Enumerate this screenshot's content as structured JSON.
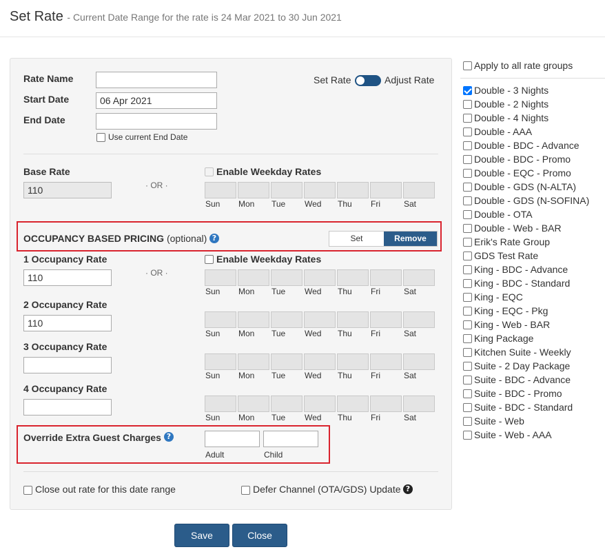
{
  "header": {
    "title": "Set Rate",
    "subtitle": "- Current Date Range for the rate is 24 Mar 2021 to 30 Jun 2021"
  },
  "form": {
    "rate_name_label": "Rate Name",
    "rate_name_value": "",
    "start_date_label": "Start Date",
    "start_date_value": "06 Apr 2021",
    "end_date_label": "End Date",
    "end_date_value": "",
    "use_current_end_date": "Use current End Date",
    "set_rate_label": "Set Rate",
    "adjust_rate_label": "Adjust Rate",
    "base_rate_label": "Base Rate",
    "base_rate_value": "110",
    "or": "· OR ·",
    "enable_weekday_rates": "Enable Weekday Rates",
    "days": [
      "Sun",
      "Mon",
      "Tue",
      "Wed",
      "Thu",
      "Fri",
      "Sat"
    ]
  },
  "occupancy": {
    "title": "OCCUPANCY BASED PRICING",
    "optional": "(optional)",
    "set_label": "Set",
    "remove_label": "Remove",
    "rates": [
      {
        "label": "1 Occupancy Rate",
        "value": "110"
      },
      {
        "label": "2 Occupancy Rate",
        "value": "110"
      },
      {
        "label": "3 Occupancy Rate",
        "value": ""
      },
      {
        "label": "4 Occupancy Rate",
        "value": ""
      }
    ]
  },
  "extra_guest": {
    "label": "Override Extra Guest Charges",
    "adult_label": "Adult",
    "child_label": "Child"
  },
  "footer_options": {
    "close_out": "Close out rate for this date range",
    "defer_channel": "Defer Channel (OTA/GDS) Update"
  },
  "buttons": {
    "save": "Save",
    "close": "Close"
  },
  "rate_groups": {
    "apply_all": "Apply to all rate groups",
    "items": [
      {
        "label": "Double - 3 Nights",
        "checked": true
      },
      {
        "label": "Double - 2 Nights",
        "checked": false
      },
      {
        "label": "Double - 4 Nights",
        "checked": false
      },
      {
        "label": "Double - AAA",
        "checked": false
      },
      {
        "label": "Double - BDC - Advance",
        "checked": false
      },
      {
        "label": "Double - BDC - Promo",
        "checked": false
      },
      {
        "label": "Double - EQC - Promo",
        "checked": false
      },
      {
        "label": "Double - GDS (N-ALTA)",
        "checked": false
      },
      {
        "label": "Double - GDS (N-SOFINA)",
        "checked": false
      },
      {
        "label": "Double - OTA",
        "checked": false
      },
      {
        "label": "Double - Web - BAR",
        "checked": false
      },
      {
        "label": "Erik's Rate Group",
        "checked": false
      },
      {
        "label": "GDS Test Rate",
        "checked": false
      },
      {
        "label": "King - BDC - Advance",
        "checked": false
      },
      {
        "label": "King - BDC - Standard",
        "checked": false
      },
      {
        "label": "King - EQC",
        "checked": false
      },
      {
        "label": "King - EQC - Pkg",
        "checked": false
      },
      {
        "label": "King - Web - BAR",
        "checked": false
      },
      {
        "label": "King Package",
        "checked": false
      },
      {
        "label": "Kitchen Suite - Weekly",
        "checked": false
      },
      {
        "label": "Suite - 2 Day Package",
        "checked": false
      },
      {
        "label": "Suite - BDC - Advance",
        "checked": false
      },
      {
        "label": "Suite - BDC - Promo",
        "checked": false
      },
      {
        "label": "Suite - BDC - Standard",
        "checked": false
      },
      {
        "label": "Suite - Web",
        "checked": false
      },
      {
        "label": "Suite - Web - AAA",
        "checked": false
      }
    ]
  },
  "colors": {
    "primary_button": "#2b5c8a",
    "highlight_box": "#d9232d",
    "checkbox_checked": "#0075ff",
    "info_icon": "#2f77c0"
  }
}
